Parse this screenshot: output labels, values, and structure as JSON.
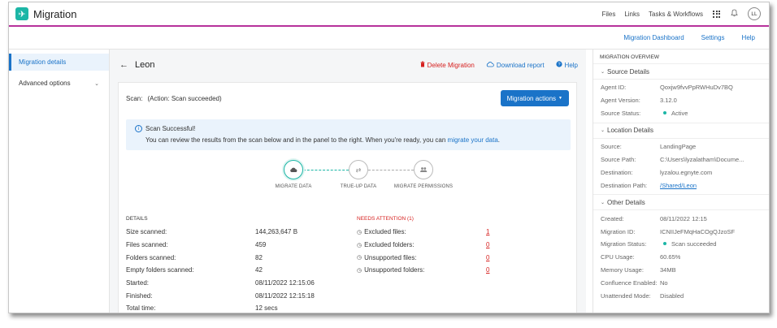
{
  "app": {
    "title": "Migration",
    "logo_glyph": "✈"
  },
  "topnav": {
    "files": "Files",
    "links": "Links",
    "tasks": "Tasks & Workflows",
    "avatar": "LL"
  },
  "subnav": {
    "dashboard": "Migration Dashboard",
    "settings": "Settings",
    "help": "Help"
  },
  "sidebar": {
    "items": [
      {
        "label": "Migration details"
      },
      {
        "label": "Advanced options"
      }
    ]
  },
  "header": {
    "title": "Leon",
    "delete": "Delete Migration",
    "download": "Download report",
    "help": "Help"
  },
  "scan": {
    "label": "Scan:",
    "value": "(Action: Scan succeeded)",
    "actions_button": "Migration actions"
  },
  "alert": {
    "title": "Scan Successful!",
    "body": "You can review the results from the scan below and in the panel to the right. When you're ready, you can",
    "link": "migrate your data",
    "end": "."
  },
  "steps": [
    "MIGRATE DATA",
    "TRUE-UP DATA",
    "MIGRATE PERMISSIONS"
  ],
  "details": {
    "heading": "DETAILS",
    "rows": [
      {
        "k": "Size scanned:",
        "v": "144,263,647 B"
      },
      {
        "k": "Files scanned:",
        "v": "459"
      },
      {
        "k": "Folders scanned:",
        "v": "82"
      },
      {
        "k": "Empty folders scanned:",
        "v": "42"
      },
      {
        "k": "Started:",
        "v": "08/11/2022 12:15:06"
      },
      {
        "k": "Finished:",
        "v": "08/11/2022 12:15:18"
      },
      {
        "k": "Total time:",
        "v": "12 secs"
      }
    ]
  },
  "attention": {
    "heading": "NEEDS ATTENTION (1)",
    "rows": [
      {
        "k": "Excluded files:",
        "v": "1"
      },
      {
        "k": "Excluded folders:",
        "v": "0"
      },
      {
        "k": "Unsupported files:",
        "v": "0"
      },
      {
        "k": "Unsupported folders:",
        "v": "0"
      }
    ]
  },
  "overview": {
    "title": "MIGRATION OVERVIEW",
    "source": {
      "heading": "Source Details",
      "agent_id": {
        "k": "Agent ID:",
        "v": "Qoxjw9fvvPpRWHuDv7BQ"
      },
      "agent_version": {
        "k": "Agent Version:",
        "v": "3.12.0"
      },
      "source_status": {
        "k": "Source Status:",
        "v": "Active"
      }
    },
    "location": {
      "heading": "Location Details",
      "source": {
        "k": "Source:",
        "v": "LandingPage"
      },
      "source_path": {
        "k": "Source Path:",
        "v": "C:\\Users\\lyzalatham\\Docume..."
      },
      "destination": {
        "k": "Destination:",
        "v": "lyzalou.egnyte.com"
      },
      "destination_path": {
        "k": "Destination Path:",
        "v": "/Shared/Leon"
      }
    },
    "other": {
      "heading": "Other Details",
      "created": {
        "k": "Created:",
        "v": "08/11/2022 12:15"
      },
      "migration_id": {
        "k": "Migration ID:",
        "v": "ICNIIJeFMqHaCOgQJzoSF"
      },
      "migration_status": {
        "k": "Migration Status:",
        "v": "Scan succeeded"
      },
      "cpu": {
        "k": "CPU Usage:",
        "v": "60.65%"
      },
      "memory": {
        "k": "Memory Usage:",
        "v": "34MB"
      },
      "confluence": {
        "k": "Confluence Enabled:",
        "v": "No"
      },
      "unattended": {
        "k": "Unattended Mode:",
        "v": "Disabled"
      }
    }
  },
  "colors": {
    "accent": "#1a73c8",
    "brand": "#1cb6a6",
    "danger": "#d6201f",
    "topbar_border": "#b7329b"
  }
}
